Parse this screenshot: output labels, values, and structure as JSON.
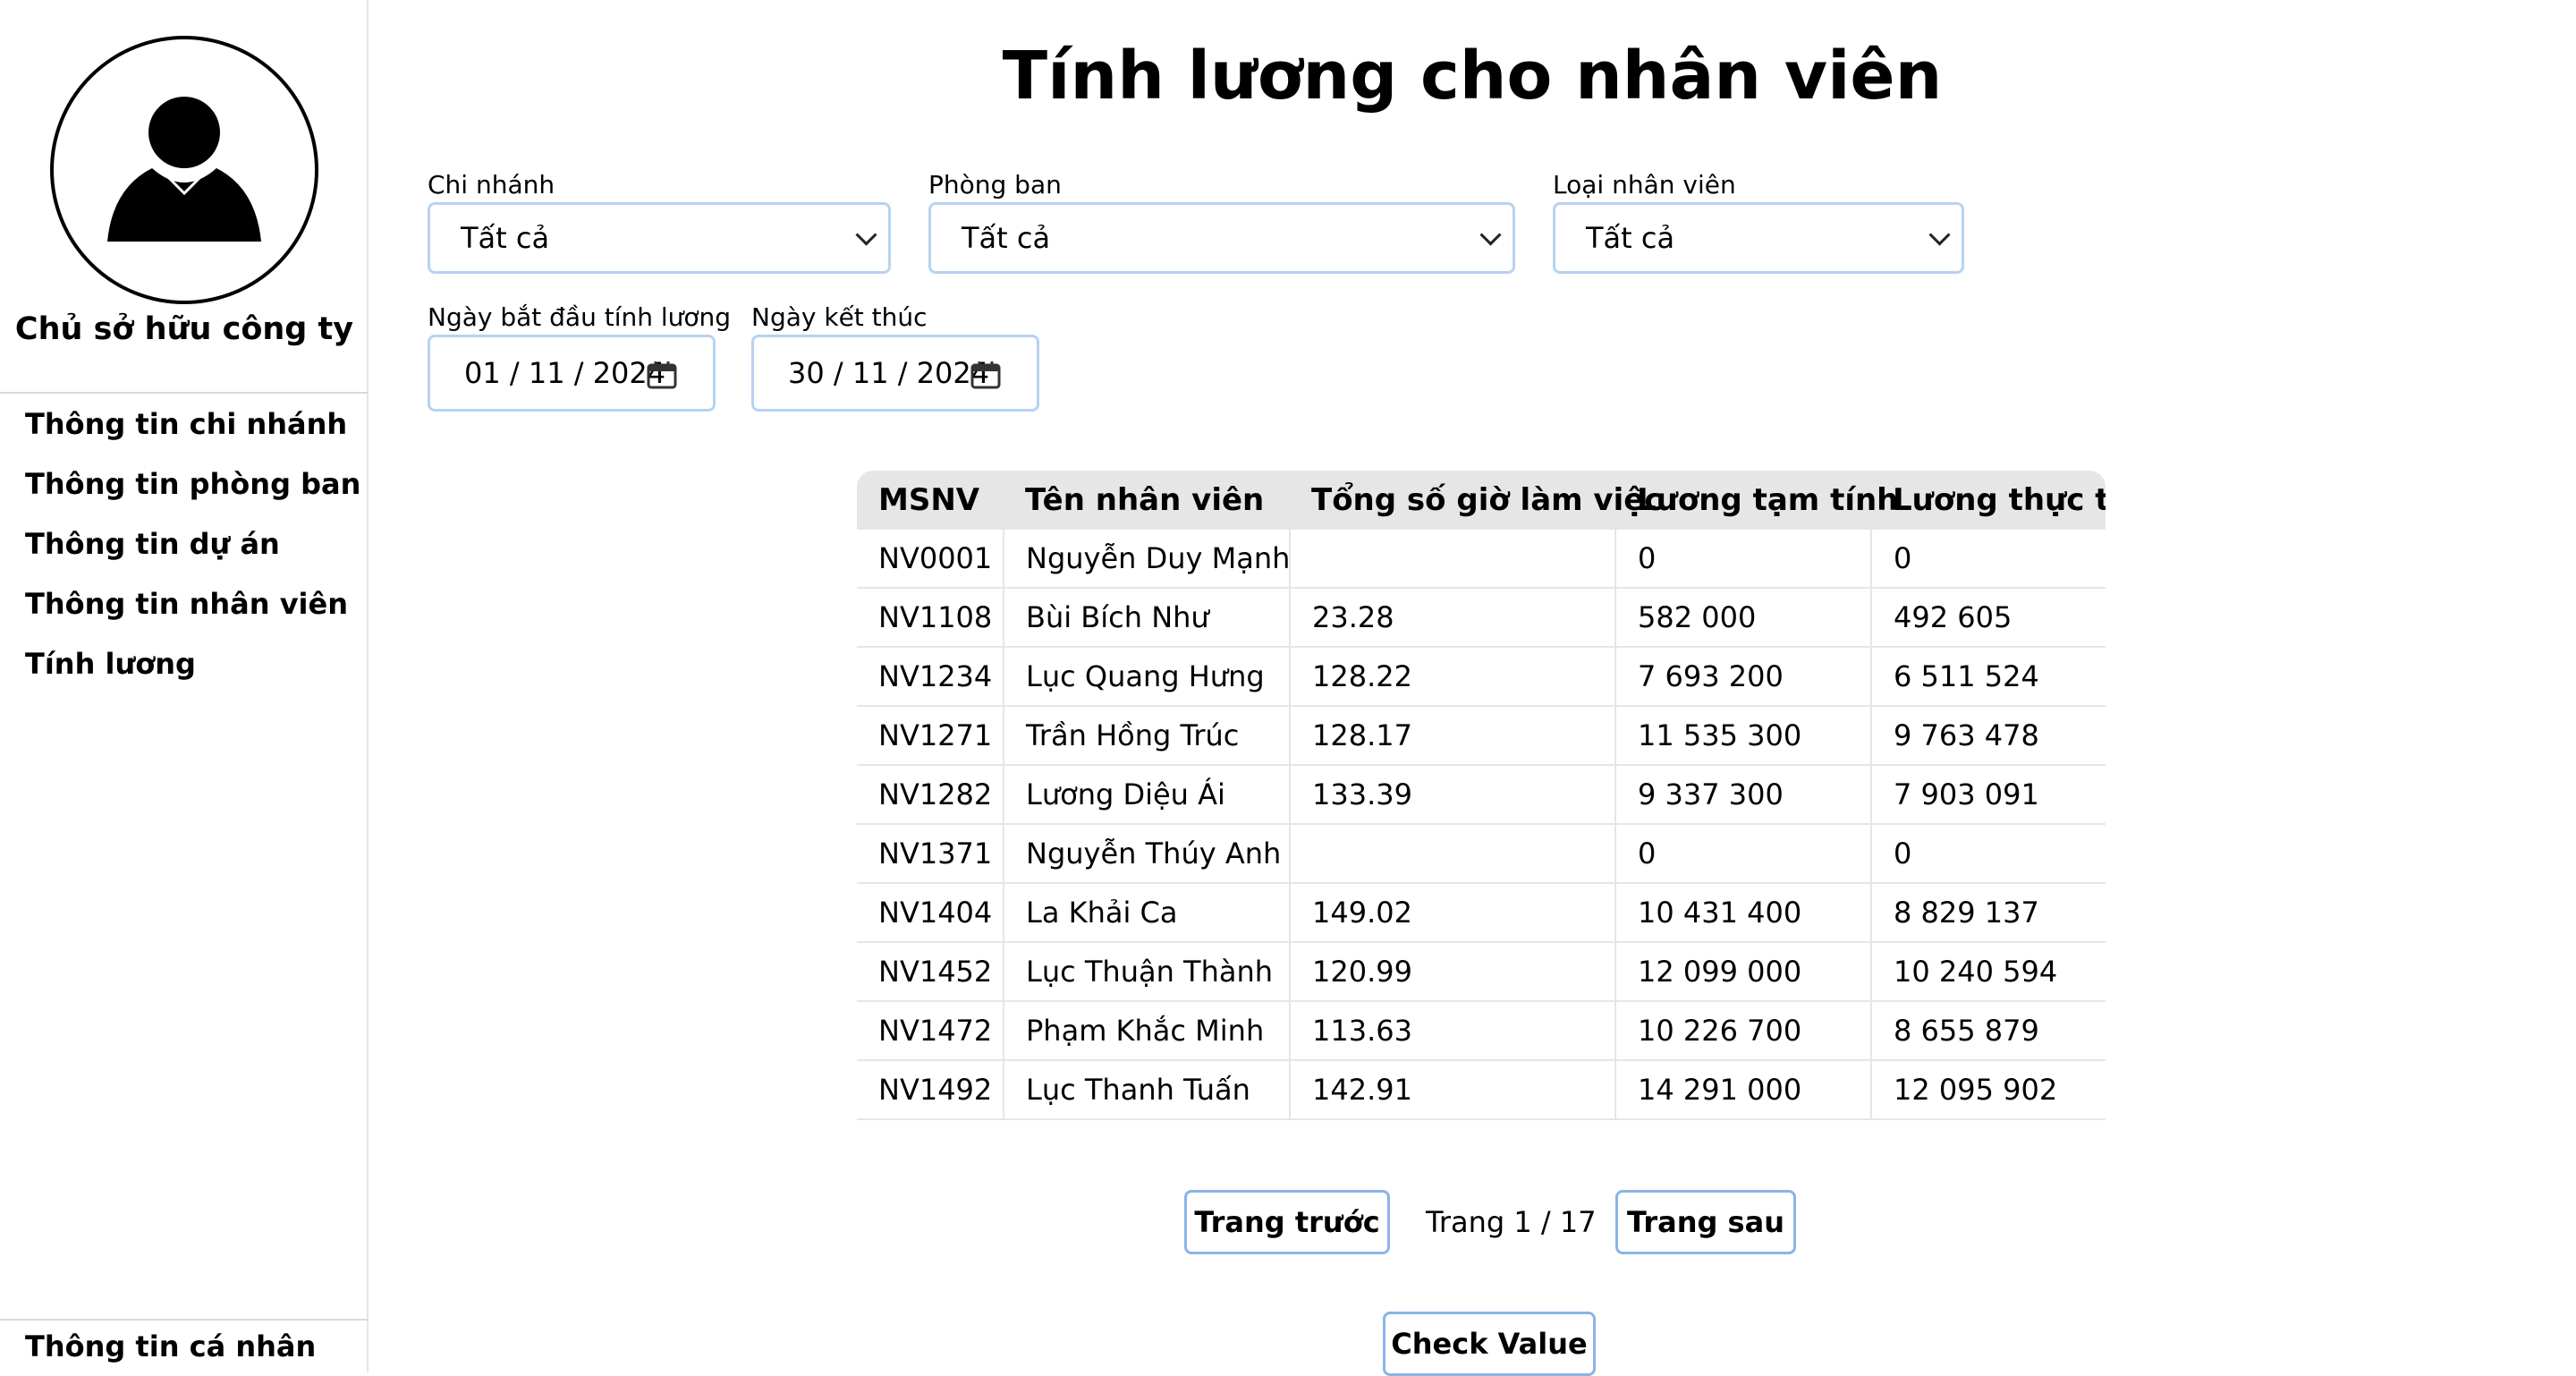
{
  "sidebar": {
    "role": "Chủ sở hữu công ty",
    "nav": [
      "Thông tin chi nhánh",
      "Thông tin phòng ban",
      "Thông tin dự án",
      "Thông tin nhân viên",
      "Tính lương"
    ],
    "profile": "Thông tin cá nhân"
  },
  "page": {
    "title": "Tính lương cho nhân viên"
  },
  "filters": {
    "branch": {
      "label": "Chi nhánh",
      "value": "Tất cả"
    },
    "department": {
      "label": "Phòng ban",
      "value": "Tất cả"
    },
    "employee_type": {
      "label": "Loại nhân viên",
      "value": "Tất cả"
    },
    "start_date": {
      "label": "Ngày bắt đầu tính lương",
      "value": "01 / 11 / 2024"
    },
    "end_date": {
      "label": "Ngày kết thúc",
      "value": "30 / 11 / 2024"
    }
  },
  "table": {
    "headers": [
      "MSNV",
      "Tên nhân viên",
      "Tổng số giờ làm việc",
      "Lương tạm tính",
      "Lương thực tế"
    ],
    "rows": [
      [
        "NV0001",
        "Nguyễn Duy Mạnh",
        "",
        "0",
        "0"
      ],
      [
        "NV1108",
        "Bùi Bích Như",
        "23.28",
        "582 000",
        "492 605"
      ],
      [
        "NV1234",
        "Lục Quang Hưng",
        "128.22",
        "7 693 200",
        "6 511 524"
      ],
      [
        "NV1271",
        "Trần Hồng Trúc",
        "128.17",
        "11 535 300",
        "9 763 478"
      ],
      [
        "NV1282",
        "Lương Diệu Ái",
        "133.39",
        "9 337 300",
        "7 903 091"
      ],
      [
        "NV1371",
        "Nguyễn Thúy Anh",
        "",
        "0",
        "0"
      ],
      [
        "NV1404",
        "La Khải Ca",
        "149.02",
        "10 431 400",
        "8 829 137"
      ],
      [
        "NV1452",
        "Lục Thuận Thành",
        "120.99",
        "12 099 000",
        "10 240 594"
      ],
      [
        "NV1472",
        "Phạm Khắc Minh",
        "113.63",
        "10 226 700",
        "8 655 879"
      ],
      [
        "NV1492",
        "Lục Thanh Tuấn",
        "142.91",
        "14 291 000",
        "12 095 902"
      ]
    ]
  },
  "pagination": {
    "prev": "Trang trước",
    "indicator": "Trang 1 / 17",
    "next": "Trang sau"
  },
  "check_button": "Check Value"
}
